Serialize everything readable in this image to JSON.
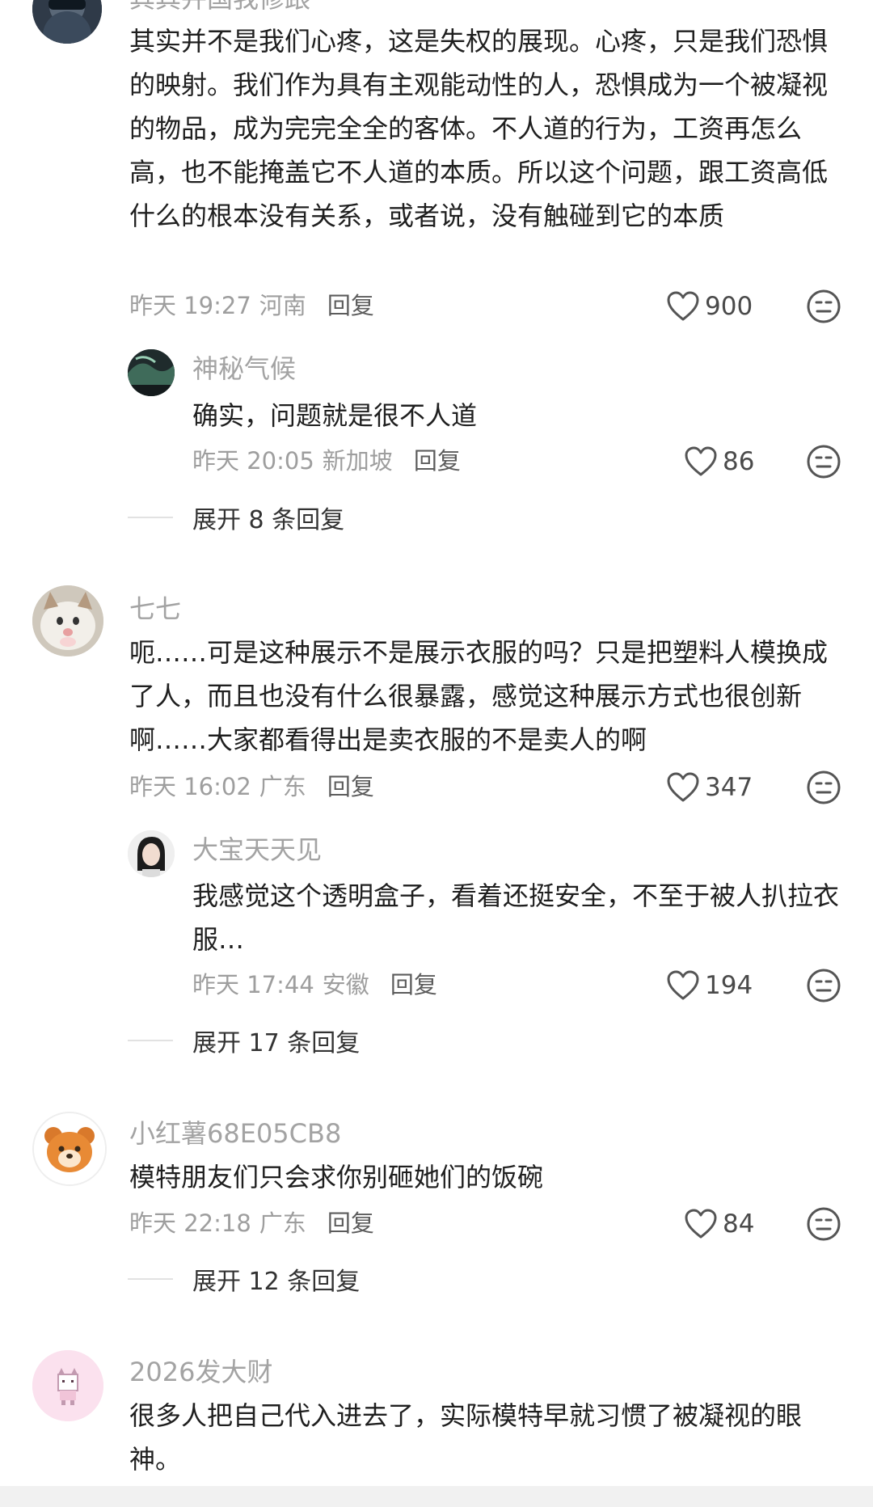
{
  "comments": [
    {
      "id": "c0",
      "name": "其其并国我修跟",
      "text": "其实并不是我们心疼，这是失权的展现。心疼，只是我们恐惧的映射。我们作为具有主观能动性的人，恐惧成为一个被凝视的物品，成为完完全全的客体。不人道的行为，工资再怎么高，也不能掩盖它不人道的本质。所以这个问题，跟工资高低什么的根本没有关系，或者说，没有触碰到它的本质",
      "time": "昨天 19:27",
      "region": "河南",
      "reply_label": "回复",
      "likes": "900",
      "replies": [
        {
          "name": "神秘气候",
          "text": "确实，问题就是很不人道",
          "time": "昨天 20:05",
          "region": "新加坡",
          "reply_label": "回复",
          "likes": "86"
        }
      ],
      "expand": "展开 8 条回复"
    },
    {
      "id": "c1",
      "name": "七七",
      "text": "呃……可是这种展示不是展示衣服的吗？只是把塑料人模换成了人，而且也没有什么很暴露，感觉这种展示方式也很创新啊……大家都看得出是卖衣服的不是卖人的啊",
      "time": "昨天 16:02",
      "region": "广东",
      "reply_label": "回复",
      "likes": "347",
      "replies": [
        {
          "name": "大宝天天见",
          "text": "我感觉这个透明盒子，看着还挺安全，不至于被人扒拉衣服…",
          "time": "昨天 17:44",
          "region": "安徽",
          "reply_label": "回复",
          "likes": "194"
        }
      ],
      "expand": "展开 17 条回复"
    },
    {
      "id": "c2",
      "name": "小红薯68E05CB8",
      "text": "模特朋友们只会求你别砸她们的饭碗",
      "time": "昨天 22:18",
      "region": "广东",
      "reply_label": "回复",
      "likes": "84",
      "expand": "展开 12 条回复"
    },
    {
      "id": "c3",
      "name": "2026发大财",
      "text": "很多人把自己代入进去了，实际模特早就习惯了被凝视的眼神。"
    }
  ],
  "icons": {
    "like": "heart-outline-icon",
    "dislike": "neutral-face-icon"
  },
  "colors": {
    "username": "#a3a3a3",
    "body_text": "#1f1f1f",
    "meta": "#9e9e9e",
    "reply": "#5c5c5c"
  }
}
